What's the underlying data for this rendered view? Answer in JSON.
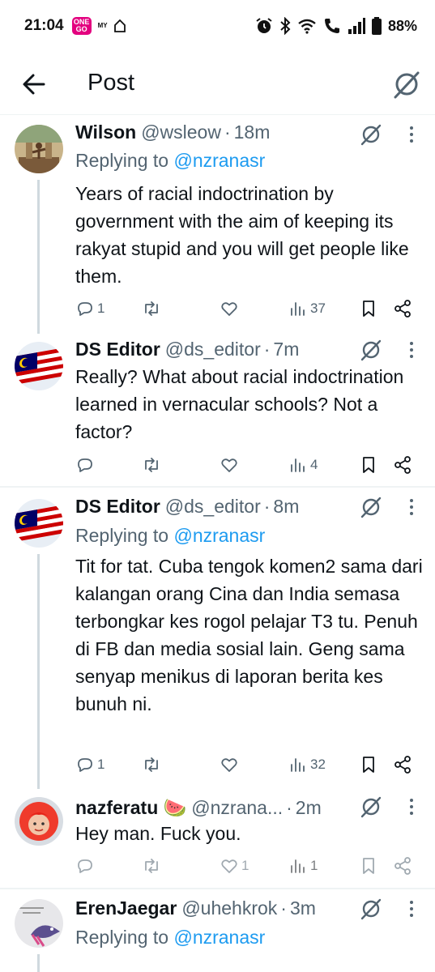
{
  "status_bar": {
    "time": "21:04",
    "go_badge": "ONE GO",
    "my_badge": "MY",
    "battery": "88%"
  },
  "header": {
    "title": "Post"
  },
  "tweets": [
    {
      "name": "Wilson",
      "handle": "@wsleow",
      "dot": "·",
      "time": "18m",
      "replying_prefix": "Replying to ",
      "replying_to": "@nzranasr",
      "text": "Years of racial indoctrination by government with the aim of keeping its rakyat stupid and you will get people like them.",
      "replies": "1",
      "views": "37"
    },
    {
      "name": "DS Editor",
      "handle": "@ds_editor",
      "dot": "·",
      "time": "7m",
      "text": "Really? What about racial indoctrination learned in vernacular schools? Not a factor?",
      "views": "4"
    },
    {
      "name": "DS Editor",
      "handle": "@ds_editor",
      "dot": "·",
      "time": "8m",
      "replying_prefix": "Replying to ",
      "replying_to": "@nzranasr",
      "text": "Tit for tat. Cuba tengok komen2 sama dari kalangan orang Cina dan India semasa terbongkar kes rogol pelajar T3 tu. Penuh di FB dan media sosial lain. Geng sama senyap menikus di laporan berita kes bunuh ni.",
      "replies": "1",
      "views": "32"
    },
    {
      "name": "nazferatu 🍉",
      "handle": "@nzrana...",
      "dot": "·",
      "time": "2m",
      "text": "Hey man. Fuck you.",
      "likes": "1",
      "views": "1"
    },
    {
      "name": "ErenJaegar",
      "handle": "@uhehkrok",
      "dot": "·",
      "time": "3m",
      "replying_prefix": "Replying to ",
      "replying_to": "@nzranasr"
    }
  ],
  "colors": {
    "accent": "#1d9bf0",
    "secondary_text": "#536471",
    "thread_line": "#cfd9de",
    "divider": "#eff3f4"
  },
  "icons": [
    "back-arrow-icon",
    "grok-icon",
    "more-icon",
    "reply-icon",
    "retweet-icon",
    "like-icon",
    "views-icon",
    "bookmark-icon",
    "share-icon"
  ]
}
